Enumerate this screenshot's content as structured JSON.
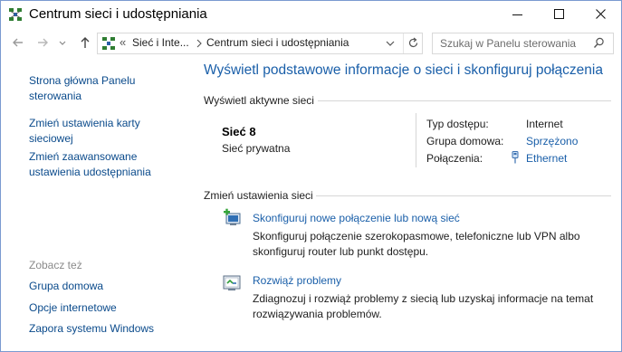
{
  "window": {
    "title": "Centrum sieci i udostępniania"
  },
  "address_bar": {
    "overflow": "«",
    "crumbs": [
      "Sieć i Inte...",
      "Centrum sieci i udostępniania"
    ]
  },
  "search": {
    "placeholder": "Szukaj w Panelu sterowania"
  },
  "left_pane": {
    "links": [
      "Strona główna Panelu sterowania",
      "Zmień ustawienia karty sieciowej",
      "Zmień zaawansowane ustawienia udostępniania"
    ],
    "see_also_label": "Zobacz też",
    "see_also": [
      "Grupa domowa",
      "Opcje internetowe",
      "Zapora systemu Windows"
    ]
  },
  "main": {
    "title": "Wyświetl podstawowe informacje o sieci i skonfiguruj połączenia",
    "active_networks_label": "Wyświetl aktywne sieci",
    "network": {
      "name": "Sieć 8",
      "type": "Sieć prywatna",
      "access_type_label": "Typ dostępu:",
      "access_type_value": "Internet",
      "homegroup_label": "Grupa domowa:",
      "homegroup_value": "Sprzężono",
      "connections_label": "Połączenia:",
      "connections_value": "Ethernet"
    },
    "change_settings_label": "Zmień ustawienia sieci",
    "tasks": [
      {
        "link": "Skonfiguruj nowe połączenie lub nową sieć",
        "desc": "Skonfiguruj połączenie szerokopasmowe, telefoniczne lub VPN albo skonfiguruj router lub punkt dostępu."
      },
      {
        "link": "Rozwiąż problemy",
        "desc": "Zdiagnozuj i rozwiąż problemy z siecią lub uzyskaj informacje na temat rozwiązywania problemów."
      }
    ]
  },
  "colors": {
    "link": "#1a5fa9",
    "left_link": "#0a4a8b",
    "title": "#1a5fa9",
    "border": "#7a9ad0"
  },
  "icons": {
    "app": "network-center-icon",
    "back": "back-arrow-icon",
    "forward": "forward-arrow-icon",
    "recent": "chevron-down-icon",
    "up": "up-arrow-icon",
    "refresh": "refresh-icon",
    "search": "search-icon",
    "ethernet": "ethernet-icon",
    "new_connection": "new-connection-icon",
    "troubleshoot": "troubleshoot-icon"
  }
}
